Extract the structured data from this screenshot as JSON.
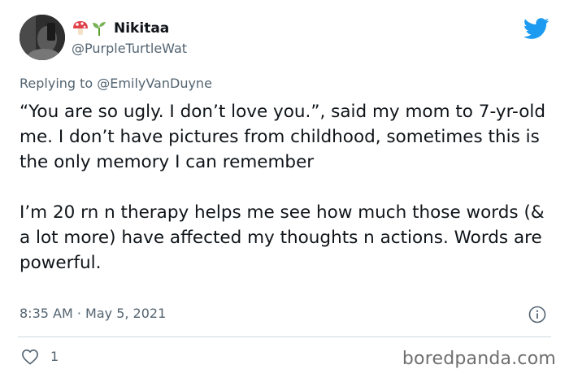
{
  "author": {
    "display_name": "Nikitaa",
    "handle": "@PurpleTurtleWat",
    "name_emoji": [
      "mushroom-icon",
      "seedling-icon"
    ]
  },
  "reply": {
    "prefix": "Replying to",
    "mention": "@EmilyVanDuyne"
  },
  "tweet": {
    "paragraphs": [
      "“You are so ugly. I don’t love you.”, said my mom to 7-yr-old me. I don’t have pictures from childhood, sometimes this is the only memory I can remember",
      "I’m 20 rn n therapy helps me see how much those words (& a lot more) have affected my thoughts n actions. Words are powerful."
    ],
    "timestamp": "8:35 AM · May 5, 2021"
  },
  "engagement": {
    "likes": "1"
  },
  "watermark": "boredpanda.com",
  "colors": {
    "twitter_blue": "#1d9bf0",
    "secondary_text": "#536471"
  }
}
